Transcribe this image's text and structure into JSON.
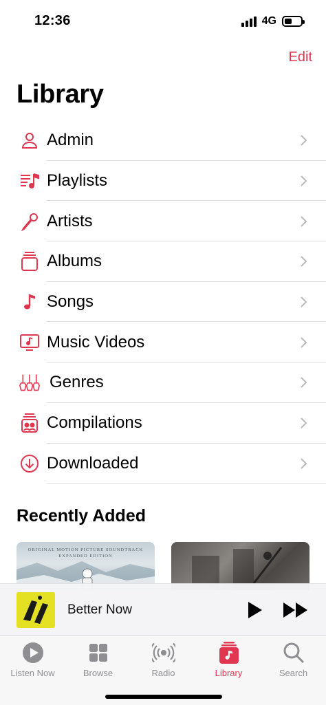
{
  "status": {
    "time": "12:36",
    "network": "4G",
    "battery_level": 0.45
  },
  "header": {
    "edit_label": "Edit",
    "title": "Library"
  },
  "library_items": [
    {
      "label": "Admin",
      "icon": "person-icon"
    },
    {
      "label": "Playlists",
      "icon": "playlist-icon"
    },
    {
      "label": "Artists",
      "icon": "microphone-icon"
    },
    {
      "label": "Albums",
      "icon": "album-stack-icon"
    },
    {
      "label": "Songs",
      "icon": "music-note-icon"
    },
    {
      "label": "Music Videos",
      "icon": "tv-music-icon"
    },
    {
      "label": "Genres",
      "icon": "guitars-icon"
    },
    {
      "label": "Compilations",
      "icon": "compilation-icon"
    },
    {
      "label": "Downloaded",
      "icon": "download-circle-icon"
    }
  ],
  "recently_added": {
    "title": "Recently Added",
    "albums": [
      {
        "caption_line1": "ORIGINAL MOTION PICTURE SOUNDTRACK",
        "caption_line2": "EXPANDED EDITION"
      },
      {
        "caption_line1": ""
      }
    ]
  },
  "now_playing": {
    "title": "Better Now"
  },
  "tabs": [
    {
      "label": "Listen Now",
      "icon": "play-circle-icon",
      "active": false
    },
    {
      "label": "Browse",
      "icon": "grid-icon",
      "active": false
    },
    {
      "label": "Radio",
      "icon": "radio-waves-icon",
      "active": false
    },
    {
      "label": "Library",
      "icon": "library-music-icon",
      "active": true
    },
    {
      "label": "Search",
      "icon": "search-icon",
      "active": false
    }
  ],
  "colors": {
    "accent": "#e0364f",
    "tab_inactive": "#8e8e93",
    "separator": "#dcdcdf"
  }
}
